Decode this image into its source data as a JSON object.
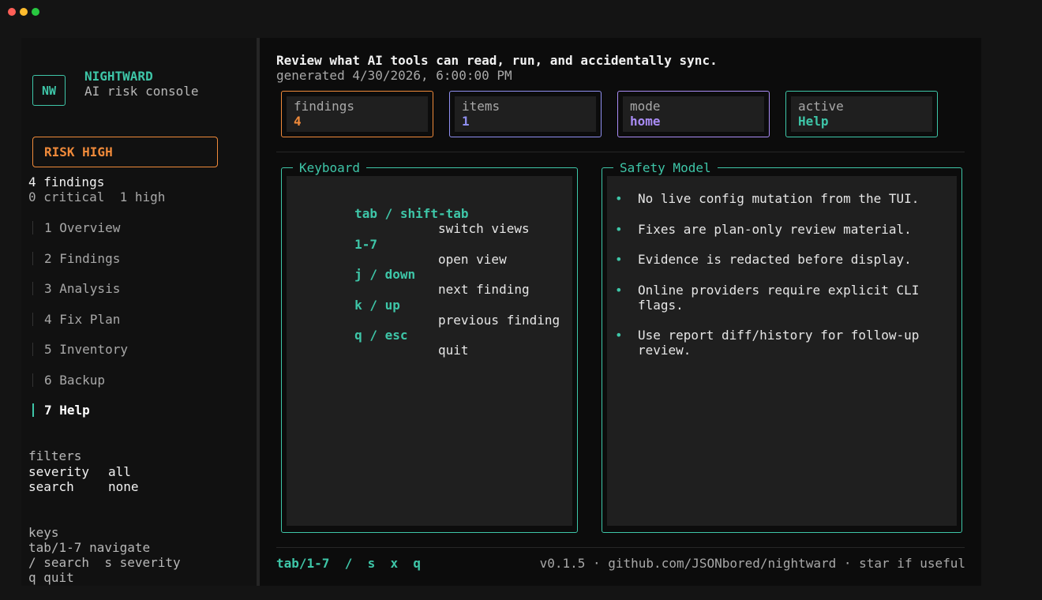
{
  "window": {
    "controls": [
      "close",
      "minimize",
      "maximize"
    ]
  },
  "sidebar": {
    "logo": "NW",
    "brand": "NIGHTWARD",
    "subtitle": "AI risk console",
    "risk": "RISK HIGH",
    "findings_count": "4 findings",
    "severity_summary": "0 critical  1 high",
    "nav": [
      {
        "label": "1 Overview",
        "active": false
      },
      {
        "label": "2 Findings",
        "active": false
      },
      {
        "label": "3 Analysis",
        "active": false
      },
      {
        "label": "4 Fix Plan",
        "active": false
      },
      {
        "label": "5 Inventory",
        "active": false
      },
      {
        "label": "6 Backup",
        "active": false
      },
      {
        "label": "7 Help",
        "active": true
      }
    ],
    "filters": {
      "heading": "filters",
      "severity_label": "severity",
      "severity_value": "all",
      "search_label": "search",
      "search_value": "none"
    },
    "keys": {
      "heading": "keys",
      "line1": "tab/1-7 navigate",
      "line2": "/ search  s severity",
      "line3": "q quit"
    }
  },
  "main": {
    "headline": "Review what AI tools can read, run, and accidentally sync.",
    "generated": "generated 4/30/2026, 6:00:00 PM",
    "cards": [
      {
        "label": "findings",
        "value": "4",
        "color": "#f08a3a",
        "value_color": "#f08a3a"
      },
      {
        "label": "items",
        "value": "1",
        "color": "#8f8ff0",
        "value_color": "#8f8ff0"
      },
      {
        "label": "mode",
        "value": "home",
        "color": "#a98cf5",
        "value_color": "#a98cf5"
      },
      {
        "label": "active",
        "value": "Help",
        "color": "#3ec6a8",
        "value_color": "#3ec6a8"
      }
    ],
    "keyboard": {
      "title": "Keyboard",
      "rows": [
        {
          "key": "tab / shift-tab",
          "desc": "switch views"
        },
        {
          "key": "1-7",
          "desc": "open view"
        },
        {
          "key": "j / down",
          "desc": "next finding"
        },
        {
          "key": "k / up",
          "desc": "previous finding"
        },
        {
          "key": "q / esc",
          "desc": "quit"
        }
      ]
    },
    "safety": {
      "title": "Safety Model",
      "bullet": "•",
      "items": [
        "No live config mutation from the TUI.",
        "Fixes are plan-only review material.",
        "Evidence is redacted before display.",
        "Online providers require explicit CLI\nflags.",
        "Use report diff/history for follow-up\nreview."
      ]
    },
    "footer": {
      "keys": "tab/1-7  /  s  x  q",
      "info": "v0.1.5 · github.com/JSONbored/nightward · star if useful"
    }
  },
  "colors": {
    "accent": "#3ec6a8",
    "risk": "#f08a3a",
    "items": "#8f8ff0",
    "mode": "#a98cf5"
  }
}
